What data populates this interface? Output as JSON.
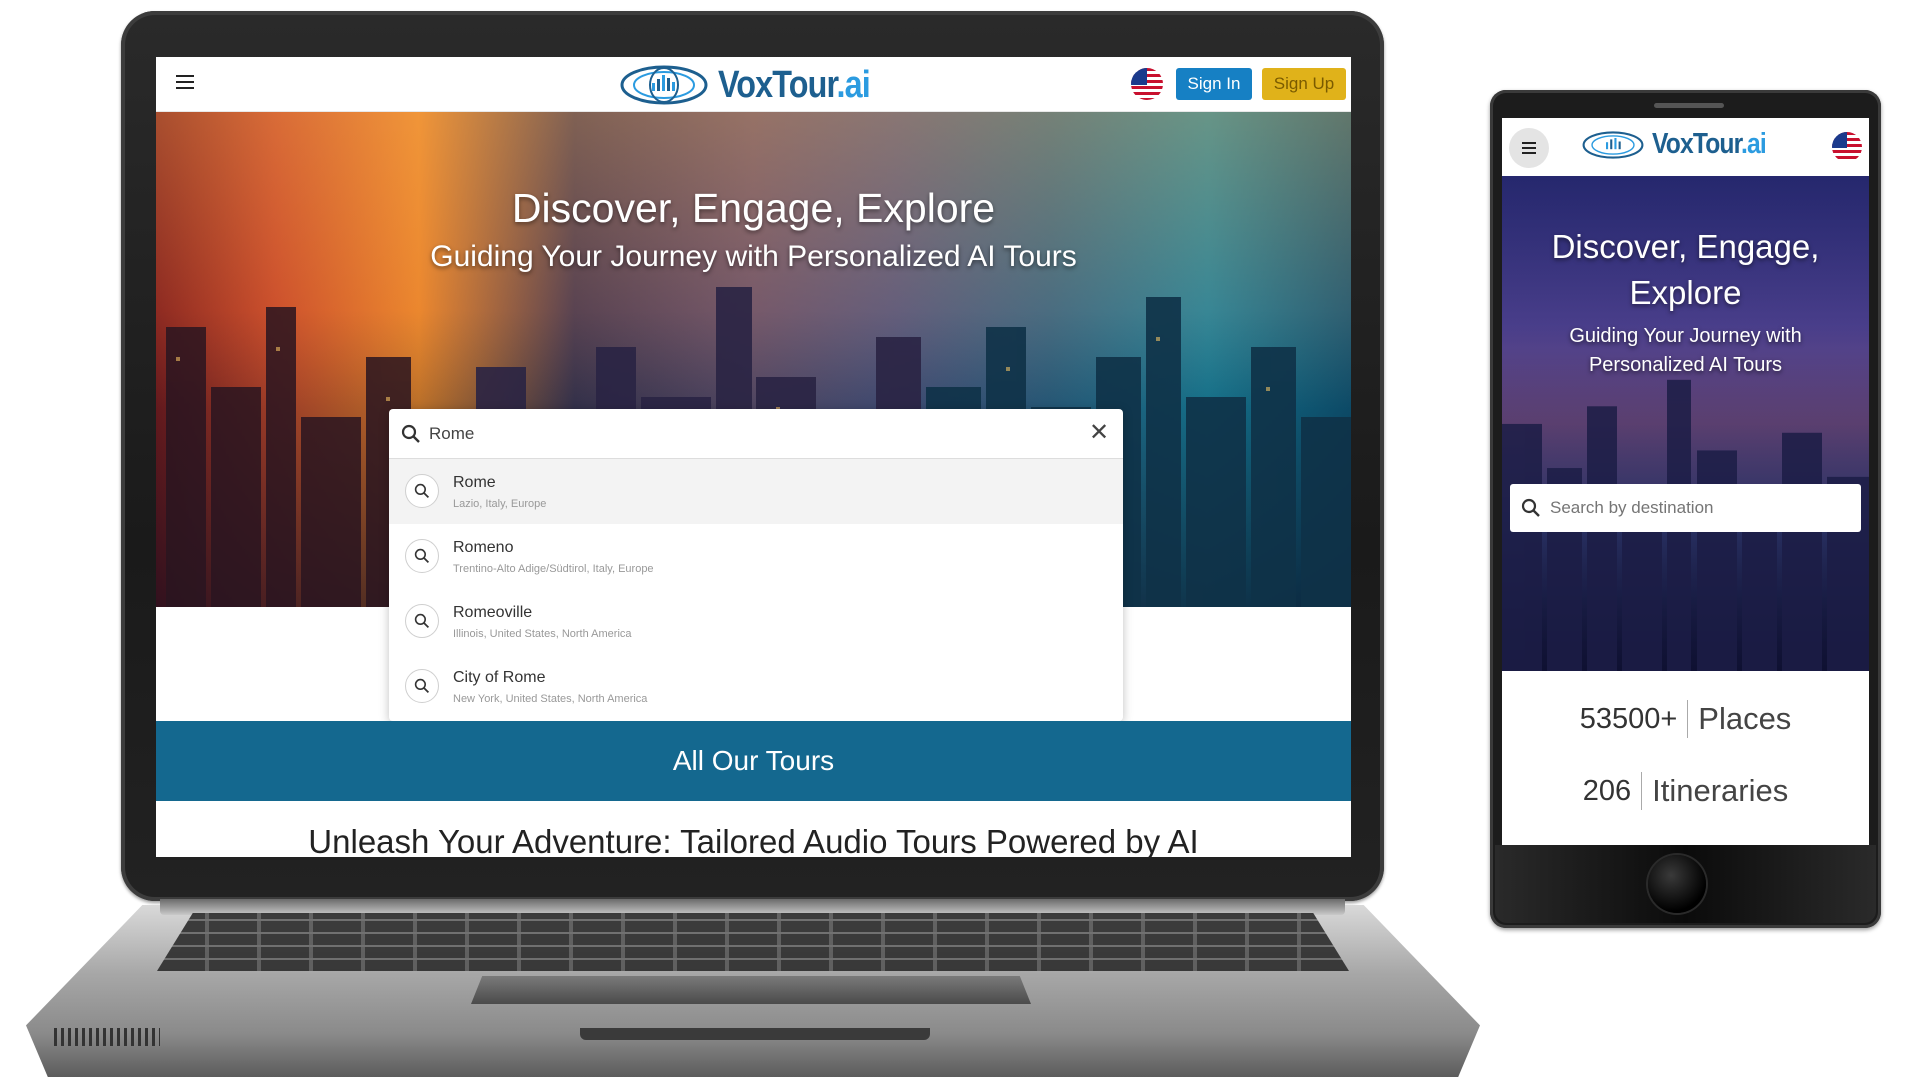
{
  "brand": {
    "name_main": "VoxTour",
    "name_suffix": ".ai"
  },
  "laptop": {
    "nav": {
      "signin_label": "Sign In",
      "signup_label": "Sign Up"
    },
    "hero": {
      "title": "Discover, Engage, Explore",
      "subtitle": "Guiding Your Journey with Personalized AI Tours"
    },
    "search": {
      "value": "Rome",
      "clear_symbol": "✕",
      "results": [
        {
          "name": "Rome",
          "sub": "Lazio, Italy, Europe"
        },
        {
          "name": "Romeno",
          "sub": "Trentino-Alto Adige/Südtirol, Italy, Europe"
        },
        {
          "name": "Romeoville",
          "sub": "Illinois, United States, North America"
        },
        {
          "name": "City of Rome",
          "sub": "New York, United States, North America"
        }
      ]
    },
    "tours_bar": {
      "label": "All Our Tours"
    },
    "tagline": "Unleash Your Adventure: Tailored Audio Tours Powered by AI"
  },
  "phone": {
    "hero": {
      "title_line1": "Discover, Engage,",
      "title_line2": "Explore",
      "subtitle_line1": "Guiding Your Journey with",
      "subtitle_line2": "Personalized AI Tours"
    },
    "search": {
      "placeholder": "Search by destination"
    },
    "stats": [
      {
        "value": "53500+",
        "label": "Places"
      },
      {
        "value": "206",
        "label": "Itineraries"
      }
    ]
  },
  "icons": {
    "menu": "hamburger-menu-icon",
    "search": "search-icon",
    "clear": "close-icon",
    "language": "us-flag-icon"
  },
  "colors": {
    "brand_dark": "#1d5f8f",
    "brand_light": "#2b9be0",
    "signin_bg": "#1680c4",
    "signup_bg": "#e0b21a",
    "tours_bar_bg": "#14688f"
  }
}
